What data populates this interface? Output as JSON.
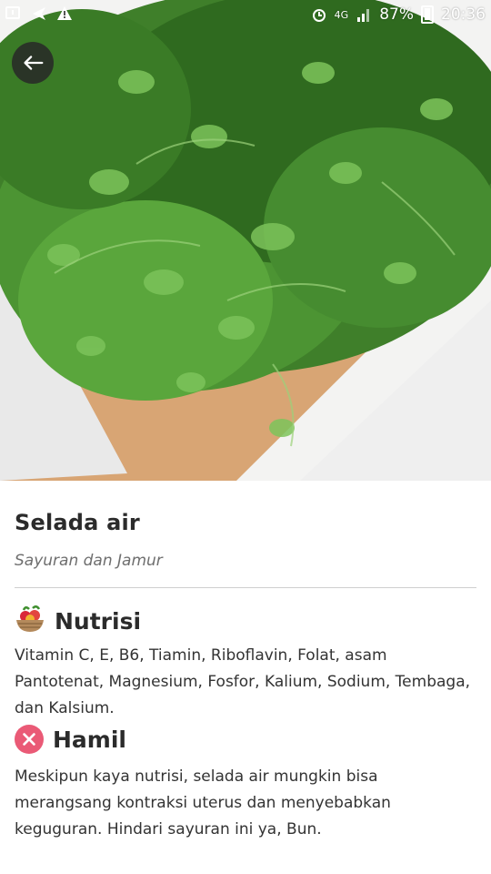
{
  "status_bar": {
    "battery": "87%",
    "time": "20:36",
    "network": "4G"
  },
  "hero": {
    "image": "watercress-on-wooden-board"
  },
  "food": {
    "name": "Selada air",
    "category": "Sayuran dan Jamur"
  },
  "nutrition": {
    "heading": "Nutrisi",
    "icon": "fruit-basket-icon",
    "text": "Vitamin C, E, B6, Tiamin, Riboflavin, Folat, asam Pantotenat, Magnesium, Fosfor, Kalium, Sodium, Tembaga, dan Kalsium."
  },
  "pregnancy": {
    "heading": "Hamil",
    "icon": "close-circle-icon",
    "text": "Meskipun kaya nutrisi, selada air mungkin bisa merangsang kontraksi uterus dan menyebabkan keguguran. Hindari sayuran ini ya, Bun."
  },
  "colors": {
    "warning_icon": "#ea5a76",
    "divider": "#cfcfcf"
  }
}
